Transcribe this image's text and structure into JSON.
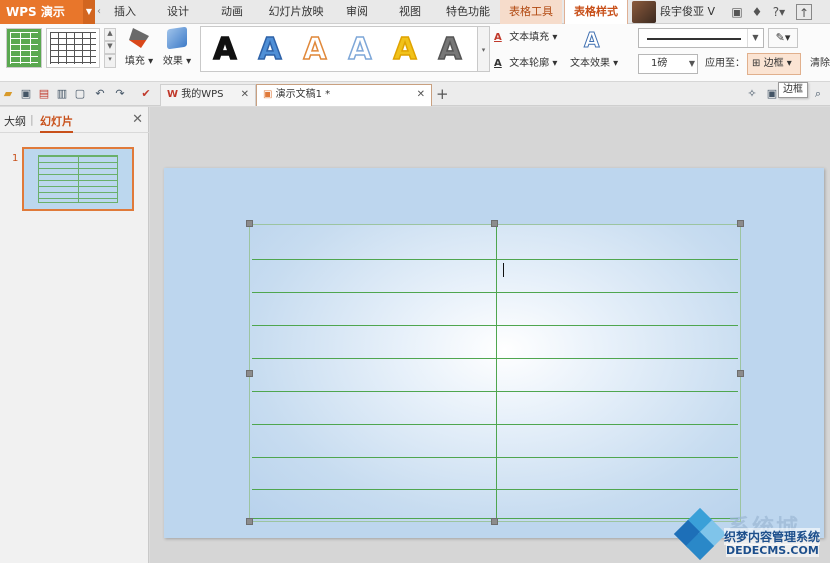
{
  "app": {
    "name": "WPS 演示"
  },
  "ribbon_tabs": [
    {
      "label": "插入"
    },
    {
      "label": "设计"
    },
    {
      "label": "动画"
    },
    {
      "label": "幻灯片放映"
    },
    {
      "label": "审阅"
    },
    {
      "label": "视图"
    },
    {
      "label": "特色功能"
    },
    {
      "label": "表格工具"
    },
    {
      "label": "表格样式"
    }
  ],
  "user": {
    "name": "段宇俊亚 V"
  },
  "title_icons": {
    "help": "?"
  },
  "ribbon": {
    "fill_label": "填充",
    "effect_label": "效果",
    "wordart": [
      {
        "glyph": "A",
        "fill": "#111111",
        "stroke": "#111111"
      },
      {
        "glyph": "A",
        "fill": "#4f8fd6",
        "stroke": "#2e62a8"
      },
      {
        "glyph": "A",
        "fill": "#ffffff",
        "stroke": "#e0883a"
      },
      {
        "glyph": "A",
        "fill": "#ffffff",
        "stroke": "#7ea7d8"
      },
      {
        "glyph": "A",
        "fill": "#f1c21a",
        "stroke": "#e0a300"
      },
      {
        "glyph": "A",
        "fill": "#777777",
        "stroke": "#555555"
      }
    ],
    "text_fill": "文本填充",
    "text_outline": "文本轮廓",
    "text_effect": "文本效果",
    "line_weight": "1磅",
    "apply_to": "应用至：",
    "border_btn": "边框",
    "clear_btn": "清除"
  },
  "doc_tabs": [
    {
      "label": "我的WPS"
    },
    {
      "label": "演示文稿1 *"
    }
  ],
  "tooltip": "边框",
  "left_panel": {
    "tab_outline": "大纲",
    "tab_separator": "|",
    "tab_slides": "幻灯片",
    "slide_number": "1"
  },
  "watermark": {
    "site": "系统城",
    "text": "织梦内容管理系统",
    "domain": "DEDECMS.COM"
  }
}
